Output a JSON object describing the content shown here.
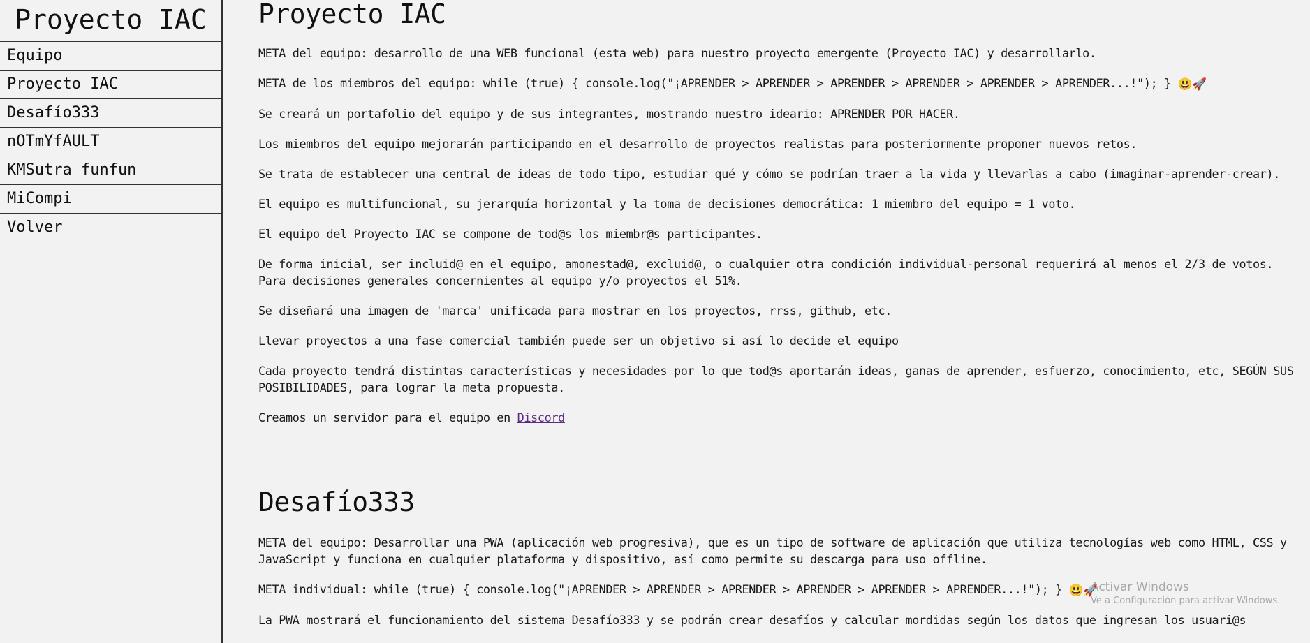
{
  "sidebar": {
    "brand": "Proyecto IAC",
    "items": [
      {
        "label": "Equipo"
      },
      {
        "label": "Proyecto IAC"
      },
      {
        "label": "Desafío333"
      },
      {
        "label": "nOTmYfAULT"
      },
      {
        "label": "KMSutra funfun"
      },
      {
        "label": "MiCompi"
      },
      {
        "label": "Volver"
      }
    ]
  },
  "sections": {
    "proyecto_iac": {
      "title": "Proyecto IAC",
      "paragraphs": [
        "META del equipo: desarrollo de una WEB funcional (esta web) para nuestro proyecto emergente (Proyecto IAC) y desarrollarlo.",
        "META de los miembros del equipo: while (true) { console.log(\"¡APRENDER > APRENDER > APRENDER > APRENDER > APRENDER > APRENDER...!\"); }",
        "Se creará un portafolio del equipo y de sus integrantes, mostrando nuestro ideario: APRENDER POR HACER.",
        "Los miembros del equipo mejorarán participando en el desarrollo de proyectos realistas para posteriormente proponer nuevos retos.",
        "Se trata de establecer una central de ideas de todo tipo, estudiar qué y cómo se podrían traer a la vida y llevarlas a cabo (imaginar-aprender-crear).",
        "El equipo es multifuncional, su jerarquía horizontal y la toma de decisiones democrática: 1 miembro del equipo = 1 voto.",
        "El equipo del Proyecto IAC se compone de tod@s los miembr@s participantes.",
        "De forma inicial, ser incluid@ en el equipo, amonestad@, excluid@, o cualquier otra condición individual-personal requerirá al menos el 2/3 de votos. Para decisiones generales concernientes al equipo y/o proyectos el 51%.",
        "Se diseñará una imagen de 'marca' unificada para mostrar en los proyectos, rrss, github, etc.",
        "Llevar proyectos a una fase comercial también puede ser un objetivo si así lo decide el equipo",
        "Cada proyecto tendrá distintas características y necesidades por lo que tod@s aportarán ideas, ganas de aprender, esfuerzo, conocimiento, etc, SEGÚN SUS POSIBILIDADES, para lograr la meta propuesta."
      ],
      "discord_prefix": "Creamos un servidor para el equipo en ",
      "discord_link": "Discord"
    },
    "desafio": {
      "title": "Desafío333",
      "paragraphs": [
        "META del equipo: Desarrollar una PWA (aplicación web progresiva), que es un tipo de software de aplicación que utiliza tecnologías web como HTML, CSS y JavaScript y funciona en cualquier plataforma y dispositivo, así como permite su descarga para uso offline.",
        "META individual: while (true) { console.log(\"¡APRENDER > APRENDER > APRENDER > APRENDER > APRENDER > APRENDER...!\"); }",
        "La PWA mostrará el funcionamiento del sistema Desafío333 y se podrán crear desafíos y calcular mordidas según los datos que ingresan los usuari@s"
      ]
    }
  },
  "emoji": {
    "smile": "😃",
    "rocket": "🚀"
  },
  "watermark": {
    "title": "Activar Windows",
    "subtitle": "Ve a Configuración para activar Windows."
  }
}
